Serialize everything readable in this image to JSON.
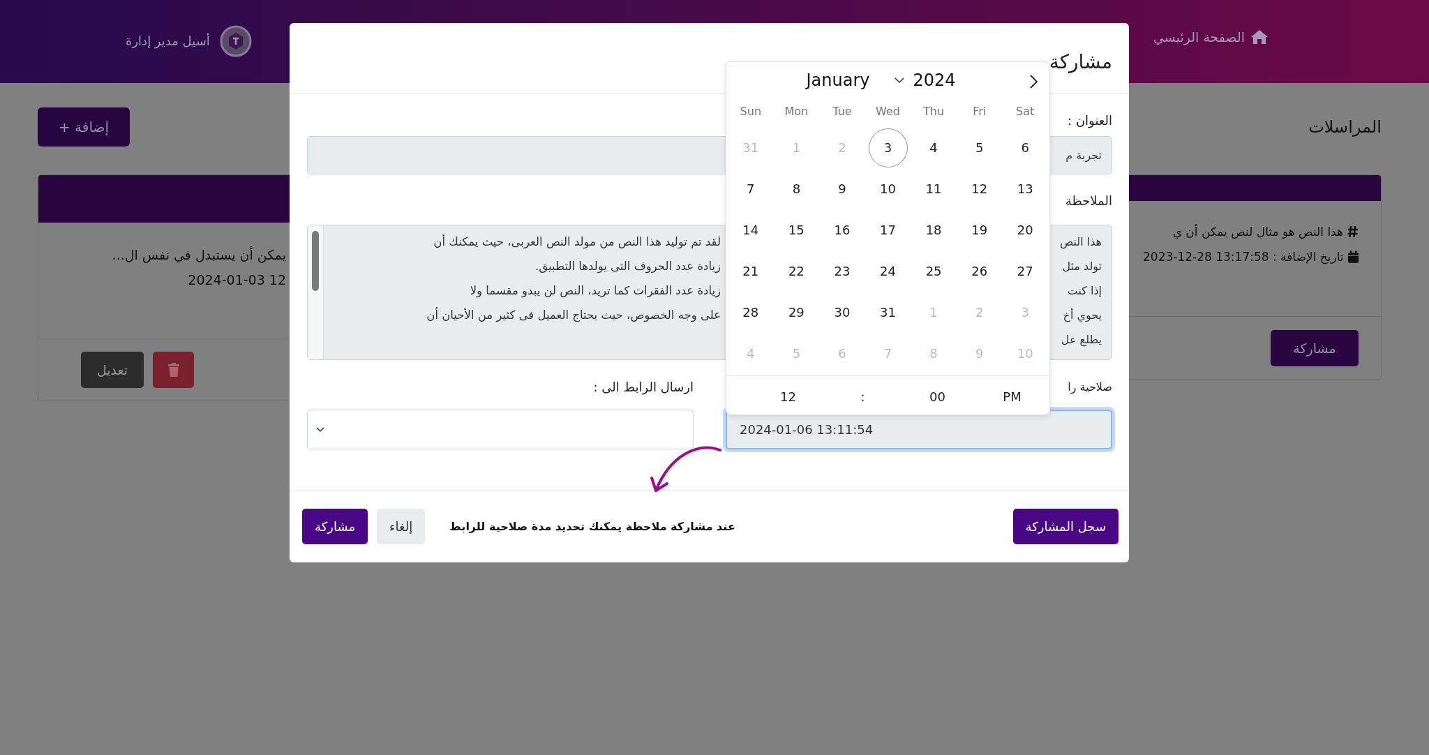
{
  "header": {
    "home_link": "الصفحة الرئيسي",
    "user_name": "أسيل مدير إدارة"
  },
  "page": {
    "title": "المراسلات",
    "add_button": "إضافة +"
  },
  "cards": [
    {
      "lines": [
        {
          "text": "هذا النص هو مثال لنص يمكن أن ي"
        },
        {
          "text": "2023-12-28 13:17:58 : تاريخ الإضافة"
        }
      ],
      "actions": [
        {
          "kind": "share",
          "label": "مشاركة"
        }
      ]
    },
    {
      "lines": [
        {
          "text": "يمكن أن يستبدل في نفس ال..."
        },
        {
          "text": "2024-01-03 12"
        }
      ],
      "actions": [
        {
          "kind": "delete"
        },
        {
          "kind": "edit",
          "label": "تعديل"
        }
      ]
    }
  ],
  "modal": {
    "title": "مشاركة",
    "title_label": "العنوان :",
    "title_value": "تجربة م",
    "note_label": "الملاحظة",
    "note_lines_start": [
      "هذا النص",
      "تولد مثل",
      "إذا كنت",
      "يحوي أخ",
      "يطلع عل"
    ],
    "note_lines_end": [
      "لقد تم توليد هذا النص من مولد النص العربى، حيث يمكنك أن",
      "زيادة عدد الحروف التى يولدها التطبيق.",
      "زيادة عدد الفقرات كما تريد، النص لن يبدو مقسما ولا",
      "على وجه الخصوص، حيث يحتاج العميل فى كثير من الأحيان أن"
    ],
    "expiry_label": "صلاحية را",
    "expiry_value": "2024-01-06 13:11:54",
    "send_label": "ارسال الرابط الى :",
    "footer_note": "عند مشاركة ملاحظة يمكنك تحديد مدة صلاحية للرابط",
    "buttons": [
      {
        "kind": "primary",
        "label": "سجل المشاركة"
      },
      {
        "kind": "secondary",
        "label": "إلغاء"
      },
      {
        "kind": "primary",
        "label": "مشاركة"
      }
    ]
  },
  "datepicker": {
    "month": "January",
    "year": "2024",
    "weekdays": [
      "Sat",
      "Fri",
      "Thu",
      "Wed",
      "Tue",
      "Mon",
      "Sun"
    ],
    "days": [
      {
        "day": "6",
        "outside": false,
        "selected": false
      },
      {
        "day": "5",
        "outside": false,
        "selected": false
      },
      {
        "day": "4",
        "outside": false,
        "selected": false
      },
      {
        "day": "3",
        "outside": false,
        "selected": true
      },
      {
        "day": "2",
        "outside": true,
        "selected": false
      },
      {
        "day": "1",
        "outside": true,
        "selected": false
      },
      {
        "day": "31",
        "outside": true,
        "selected": false
      },
      {
        "day": "13",
        "outside": false,
        "selected": false
      },
      {
        "day": "12",
        "outside": false,
        "selected": false
      },
      {
        "day": "11",
        "outside": false,
        "selected": false
      },
      {
        "day": "10",
        "outside": false,
        "selected": false
      },
      {
        "day": "9",
        "outside": false,
        "selected": false
      },
      {
        "day": "8",
        "outside": false,
        "selected": false
      },
      {
        "day": "7",
        "outside": false,
        "selected": false
      },
      {
        "day": "20",
        "outside": false,
        "selected": false
      },
      {
        "day": "19",
        "outside": false,
        "selected": false
      },
      {
        "day": "18",
        "outside": false,
        "selected": false
      },
      {
        "day": "17",
        "outside": false,
        "selected": false
      },
      {
        "day": "16",
        "outside": false,
        "selected": false
      },
      {
        "day": "15",
        "outside": false,
        "selected": false
      },
      {
        "day": "14",
        "outside": false,
        "selected": false
      },
      {
        "day": "27",
        "outside": false,
        "selected": false
      },
      {
        "day": "26",
        "outside": false,
        "selected": false
      },
      {
        "day": "25",
        "outside": false,
        "selected": false
      },
      {
        "day": "24",
        "outside": false,
        "selected": false
      },
      {
        "day": "23",
        "outside": false,
        "selected": false
      },
      {
        "day": "22",
        "outside": false,
        "selected": false
      },
      {
        "day": "21",
        "outside": false,
        "selected": false
      },
      {
        "day": "3",
        "outside": true,
        "selected": false
      },
      {
        "day": "2",
        "outside": true,
        "selected": false
      },
      {
        "day": "1",
        "outside": true,
        "selected": false
      },
      {
        "day": "31",
        "outside": false,
        "selected": false
      },
      {
        "day": "30",
        "outside": false,
        "selected": false
      },
      {
        "day": "29",
        "outside": false,
        "selected": false
      },
      {
        "day": "28",
        "outside": false,
        "selected": false
      },
      {
        "day": "10",
        "outside": true,
        "selected": false
      },
      {
        "day": "9",
        "outside": true,
        "selected": false
      },
      {
        "day": "8",
        "outside": true,
        "selected": false
      },
      {
        "day": "7",
        "outside": true,
        "selected": false
      },
      {
        "day": "6",
        "outside": true,
        "selected": false
      },
      {
        "day": "5",
        "outside": true,
        "selected": false
      },
      {
        "day": "4",
        "outside": true,
        "selected": false
      }
    ],
    "time": {
      "hour": "12",
      "separator": ":",
      "minute": "00",
      "period": "PM"
    }
  }
}
